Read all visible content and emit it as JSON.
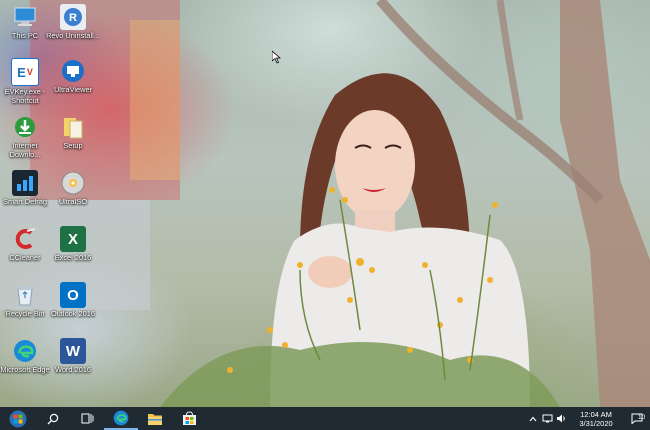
{
  "desktop": {
    "icons": [
      {
        "label": "This PC",
        "icon": "this-pc-icon"
      },
      {
        "label": "Revo Uninstall...",
        "icon": "revo-uninstaller-icon"
      },
      {
        "label": "EVKey.exe - Shortcut",
        "icon": "evkey-icon"
      },
      {
        "label": "UltraViewer",
        "icon": "ultraviewer-icon"
      },
      {
        "label": "Internet Downlo...",
        "icon": "internet-download-manager-icon"
      },
      {
        "label": "Setup",
        "icon": "setup-icon"
      },
      {
        "label": "Smart Defrag",
        "icon": "smart-defrag-icon"
      },
      {
        "label": "UltraISO",
        "icon": "ultraiso-icon"
      },
      {
        "label": "CCleaner",
        "icon": "ccleaner-icon"
      },
      {
        "label": "Excel 2016",
        "icon": "excel-icon"
      },
      {
        "label": "Recycle Bin",
        "icon": "recycle-bin-icon"
      },
      {
        "label": "Outlook 2016",
        "icon": "outlook-icon"
      },
      {
        "label": "Microsoft Edge",
        "icon": "edge-icon"
      },
      {
        "label": "Word 2016",
        "icon": "word-icon"
      }
    ]
  },
  "taskbar": {
    "buttons": [
      {
        "name": "start-button",
        "icon": "windows-start-icon"
      },
      {
        "name": "search-button",
        "icon": "search-icon"
      },
      {
        "name": "task-view-button",
        "icon": "task-view-icon"
      },
      {
        "name": "edge-taskbar-button",
        "icon": "edge-icon"
      },
      {
        "name": "file-explorer-taskbar-button",
        "icon": "folder-icon"
      },
      {
        "name": "store-taskbar-button",
        "icon": "store-icon"
      }
    ],
    "tray": {
      "time": "12:04 AM",
      "date": "3/31/2020",
      "notification_count": "10"
    }
  },
  "colors": {
    "taskbar": "#1f2a33",
    "active_indicator": "#7fb5e8",
    "excel": "#1e7145",
    "word": "#2b579a",
    "outlook": "#0072c6"
  }
}
